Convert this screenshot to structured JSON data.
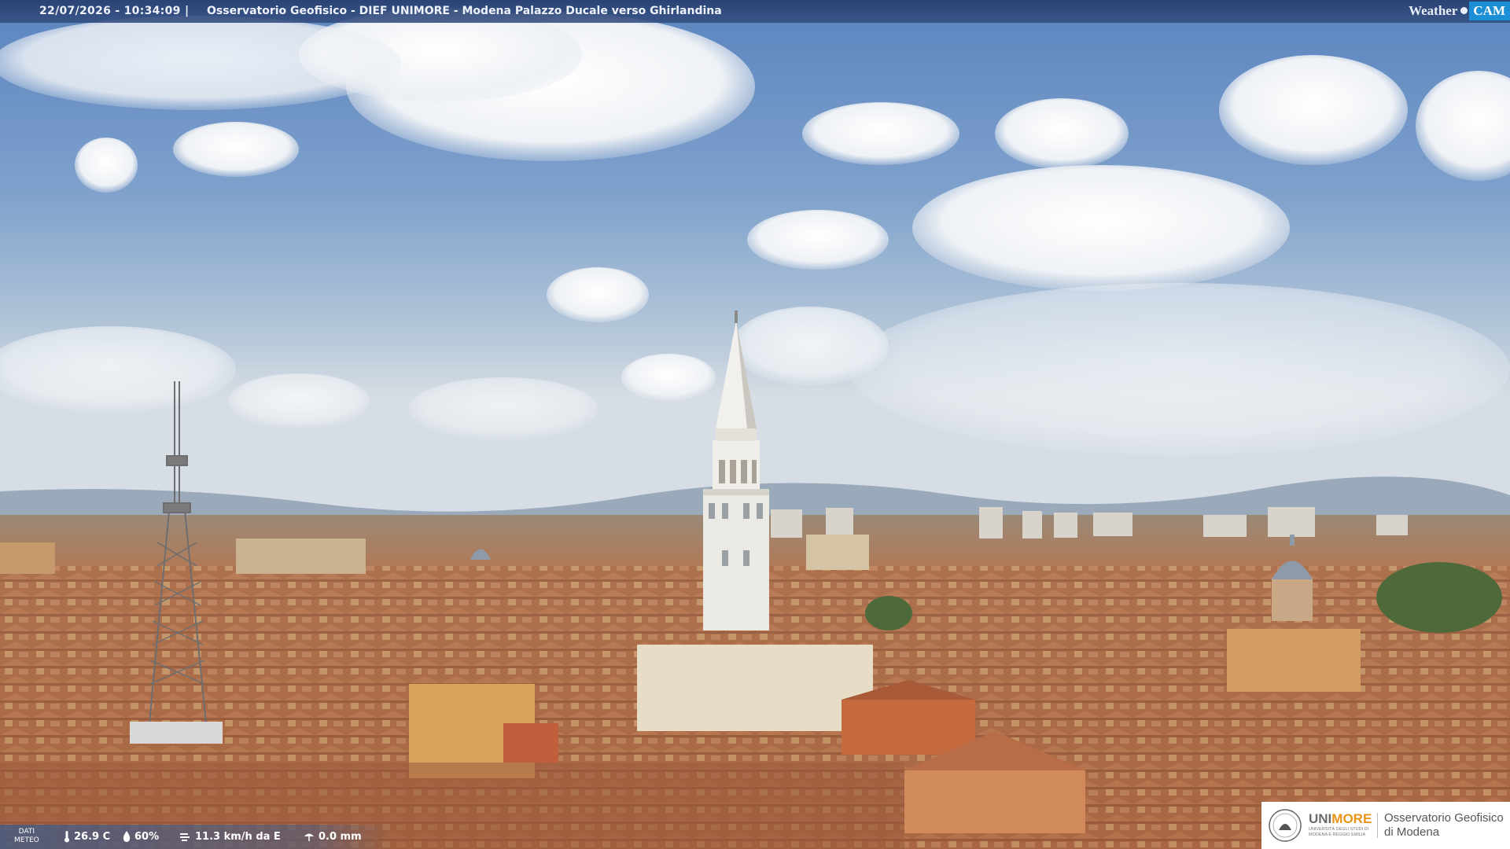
{
  "overlay": {
    "timestamp": "22/07/2026 - 10:34:09",
    "separator": "|",
    "title": "Osservatorio Geofisico - DIEF UNIMORE - Modena Palazzo Ducale verso Ghirlandina"
  },
  "brand": {
    "weather": "Weather",
    "cam": "CAM"
  },
  "meteo": {
    "label_line1": "DATI",
    "label_line2": "METEO",
    "temperature": "26.9 C",
    "humidity": "60%",
    "wind": "11.3 km/h da E",
    "rain": "0.0 mm"
  },
  "logo": {
    "uni_prefix": "UNI",
    "uni_suffix": "MORE",
    "uni_sub": "UNIVERSITÀ DEGLI STUDI DI MODENA E REGGIO EMILIA",
    "observatory_line1": "Osservatorio Geofisico",
    "observatory_line2": "di Modena"
  },
  "colors": {
    "sky_top": "#5f87bf",
    "sky_bottom": "#dfe6ec",
    "roof": "#b8764e",
    "tower": "#e8e6e0",
    "bar": "#2f4a80",
    "unimore_orange": "#e89414"
  },
  "icons": [
    "thermometer-icon",
    "humidity-icon",
    "wind-icon",
    "rain-icon"
  ]
}
